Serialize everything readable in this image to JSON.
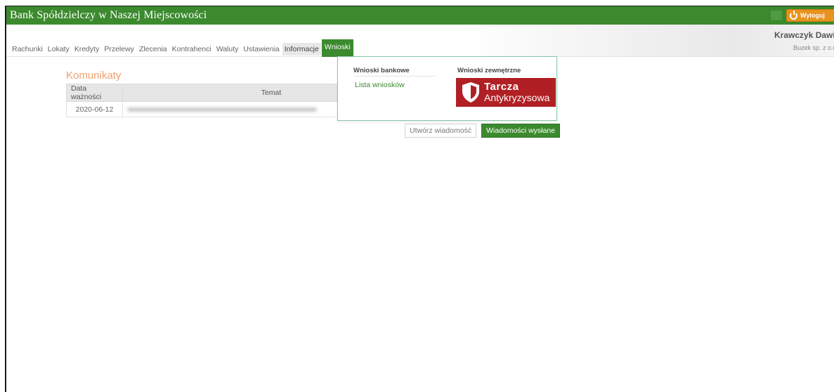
{
  "header": {
    "bank_title": "Bank Spółdzielczy w Naszej Miejscowości",
    "logout_label": "Wyloguj",
    "user_name": "Krawczyk Dawi",
    "user_company": "Buzek sp. z o.o"
  },
  "nav": {
    "items": [
      "Rachunki",
      "Lokaty",
      "Kredyty",
      "Przelewy",
      "Zlecenia",
      "Kontrahenci",
      "Waluty",
      "Ustawienia",
      "Informacje",
      "Wnioski"
    ],
    "active": "Wnioski"
  },
  "messages": {
    "title": "Komunikaty",
    "columns": [
      "Data ważności",
      "Temat"
    ],
    "rows": [
      {
        "date": "2020-06-12",
        "topic": ""
      }
    ]
  },
  "dropdown": {
    "bank_heading": "Wnioski bankowe",
    "bank_link": "Lista wniosków",
    "external_heading": "Wnioski zewnętrzne",
    "tarcza_line1": "Tarcza",
    "tarcza_line2": "Antykryzysowa"
  },
  "actions": {
    "compose_label": "Utwórz wiadomość",
    "sent_label": "Wiadomości wysłane"
  },
  "colors": {
    "brand_green": "#3b8a2e",
    "logout_orange": "#e8931e",
    "tarcza_red": "#b01f24",
    "title_orange": "#f0a070"
  }
}
